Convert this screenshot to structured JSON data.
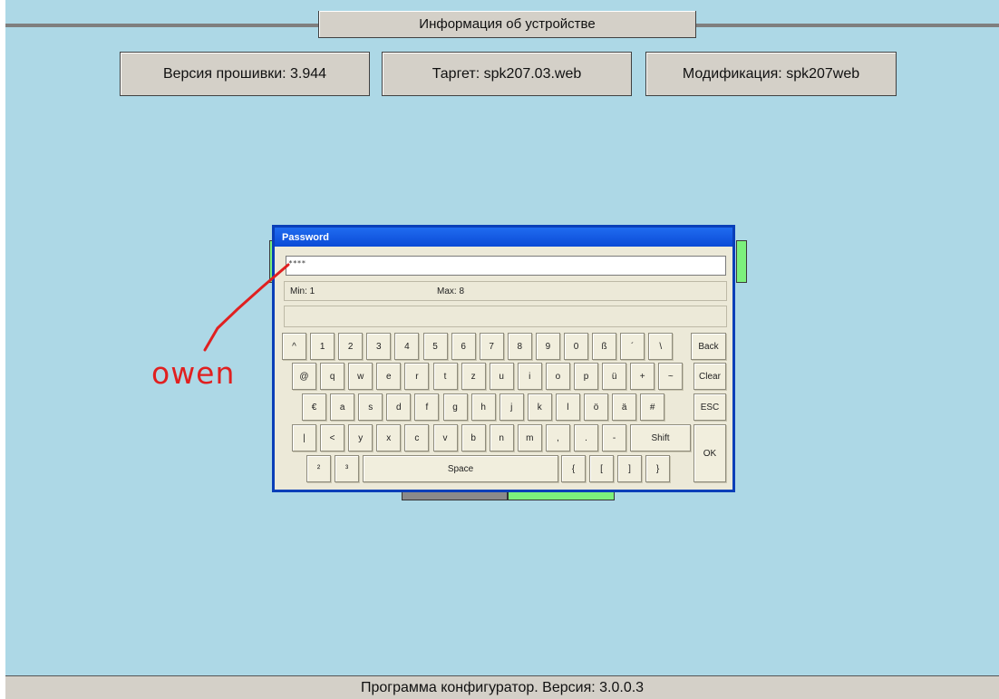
{
  "header": {
    "title": "Информация об устройстве",
    "firmware": "Версия прошивки: 3.944",
    "target": "Таргет: spk207.03.web",
    "modification": "Модификация: spk207web"
  },
  "footer": {
    "text": "Программа конфигуратор. Версия: 3.0.0.3"
  },
  "dialog": {
    "title": "Password",
    "password_value": "****",
    "min_label": "Min: 1",
    "max_label": "Max: 8"
  },
  "keyboard": {
    "row1": [
      "^",
      "1",
      "2",
      "3",
      "4",
      "5",
      "6",
      "7",
      "8",
      "9",
      "0",
      "ß",
      "´",
      "\\"
    ],
    "row2": [
      "@",
      "q",
      "w",
      "e",
      "r",
      "t",
      "z",
      "u",
      "i",
      "o",
      "p",
      "ü",
      "+",
      "~"
    ],
    "row3": [
      "€",
      "a",
      "s",
      "d",
      "f",
      "g",
      "h",
      "j",
      "k",
      "l",
      "ö",
      "ä",
      "#"
    ],
    "row4": [
      "|",
      "<",
      "y",
      "x",
      "c",
      "v",
      "b",
      "n",
      "m",
      ",",
      ".",
      "-"
    ],
    "row5_left": [
      "²",
      "³"
    ],
    "row5_right": [
      "{",
      "[",
      "]",
      "}"
    ],
    "back": "Back",
    "clear": "Clear",
    "esc": "ESC",
    "shift": "Shift",
    "ok": "OK",
    "space": "Space"
  },
  "annotation": {
    "text": "owen",
    "color": "#e02020"
  }
}
